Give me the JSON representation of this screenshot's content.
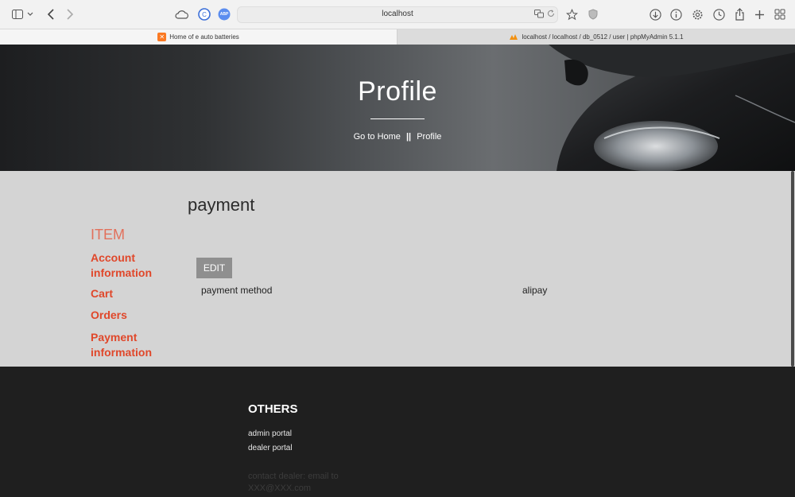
{
  "browser": {
    "url": "localhost",
    "tabs": [
      {
        "label": "Home of e auto batteries",
        "active": true
      },
      {
        "label": "localhost / localhost / db_0512 / user | phpMyAdmin 5.1.1",
        "active": false
      }
    ],
    "abp_label": "ABP"
  },
  "hero": {
    "title": "Profile",
    "breadcrumb_home": "Go to Home",
    "breadcrumb_sep": "||",
    "breadcrumb_current": "Profile"
  },
  "main": {
    "heading": "payment",
    "edit_label": "EDIT",
    "field": {
      "label": "payment method",
      "value": "alipay"
    }
  },
  "sidebar": {
    "title": "ITEM",
    "items": [
      {
        "label": "Account information"
      },
      {
        "label": "Cart"
      },
      {
        "label": "Orders"
      },
      {
        "label": "Payment information"
      }
    ]
  },
  "footer": {
    "title": "OTHERS",
    "links": [
      {
        "label": "admin portal"
      },
      {
        "label": "dealer portal"
      }
    ],
    "contact": "contact dealer: email to XXX@XXX.com"
  },
  "colors": {
    "accent_link": "#e0472a",
    "sidebar_title": "#e2705b",
    "footer_bg": "#1f1f1f",
    "content_bg": "#d4d4d4"
  }
}
